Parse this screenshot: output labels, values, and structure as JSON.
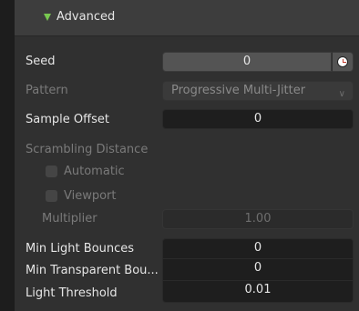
{
  "panel": {
    "title": "Advanced",
    "expanded": true,
    "accent": "#78c850"
  },
  "seed": {
    "label": "Seed",
    "value": "0",
    "icon": "clock-icon"
  },
  "pattern": {
    "label": "Pattern",
    "value": "Progressive Multi-Jitter",
    "icon": "chevron-down-icon"
  },
  "sample_offset": {
    "label": "Sample Offset",
    "value": "0"
  },
  "scrambling": {
    "label": "Scrambling Distance",
    "automatic_label": "Automatic",
    "automatic_checked": false,
    "viewport_label": "Viewport",
    "viewport_checked": false,
    "multiplier_label": "Multiplier",
    "multiplier_value": "1.00"
  },
  "bounces": {
    "min_light_label": "Min Light Bounces",
    "min_light_value": "0",
    "min_transparent_label": "Min Transparent Bou...",
    "min_transparent_value": "0",
    "light_threshold_label": "Light Threshold",
    "light_threshold_value": "0.01"
  }
}
